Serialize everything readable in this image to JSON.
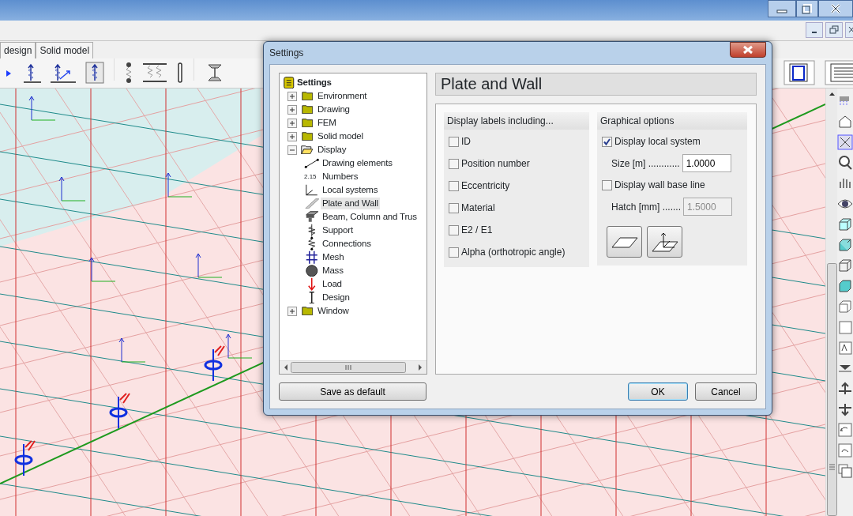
{
  "tabs": [
    {
      "label": "design"
    },
    {
      "label": "Solid model"
    }
  ],
  "dialog": {
    "title": "Settings",
    "header": "Plate and Wall",
    "tree": [
      {
        "label": "Settings",
        "kind": "root",
        "selected": false,
        "children": [
          {
            "label": "Environment",
            "kind": "folder",
            "expanded": false,
            "selected": false
          },
          {
            "label": "Drawing",
            "kind": "folder",
            "expanded": false,
            "selected": false
          },
          {
            "label": "FEM",
            "kind": "folder",
            "expanded": false,
            "selected": false
          },
          {
            "label": "Solid model",
            "kind": "folder",
            "expanded": false,
            "selected": false
          },
          {
            "label": "Display",
            "kind": "folder",
            "expanded": true,
            "selected": false,
            "children": [
              {
                "label": "Drawing elements",
                "kind": "line",
                "selected": false
              },
              {
                "label": "Numbers",
                "kind": "numbers",
                "icon_text": "2.15",
                "selected": false
              },
              {
                "label": "Local systems",
                "kind": "axes",
                "selected": false
              },
              {
                "label": "Plate and Wall",
                "kind": "plate",
                "selected": true
              },
              {
                "label": "Beam, Column and Trus",
                "kind": "beam",
                "selected": false
              },
              {
                "label": "Support",
                "kind": "spring",
                "selected": false
              },
              {
                "label": "Connections",
                "kind": "connection",
                "selected": false
              },
              {
                "label": "Mesh",
                "kind": "mesh",
                "selected": false
              },
              {
                "label": "Mass",
                "kind": "mass",
                "selected": false
              },
              {
                "label": "Load",
                "kind": "load",
                "selected": false
              },
              {
                "label": "Design",
                "kind": "design",
                "selected": false
              }
            ]
          },
          {
            "label": "Window",
            "kind": "folder",
            "expanded": false,
            "selected": false
          }
        ]
      }
    ],
    "labels_group": {
      "title": "Display labels including...",
      "options": [
        {
          "label": "ID",
          "checked": false
        },
        {
          "label": "Position number",
          "checked": false
        },
        {
          "label": "Eccentricity",
          "checked": false
        },
        {
          "label": "Material",
          "checked": false
        },
        {
          "label": "E2 / E1",
          "checked": false
        },
        {
          "label": "Alpha (orthotropic angle)",
          "checked": false
        }
      ]
    },
    "graphical_group": {
      "title": "Graphical options",
      "items": [
        {
          "kind": "checkbox",
          "label": "Display local system",
          "checked": true
        },
        {
          "kind": "field",
          "label": "Size [m] ............",
          "value": "1.0000",
          "disabled": false
        },
        {
          "kind": "checkbox",
          "label": "Display wall base line",
          "checked": false
        },
        {
          "kind": "field",
          "label": "Hatch [mm] .......",
          "value": "1.5000",
          "disabled": true
        }
      ]
    },
    "buttons": [
      {
        "label": "Save as default",
        "default": false
      },
      {
        "label": "OK",
        "default": true
      },
      {
        "label": "Cancel",
        "default": false
      }
    ]
  }
}
